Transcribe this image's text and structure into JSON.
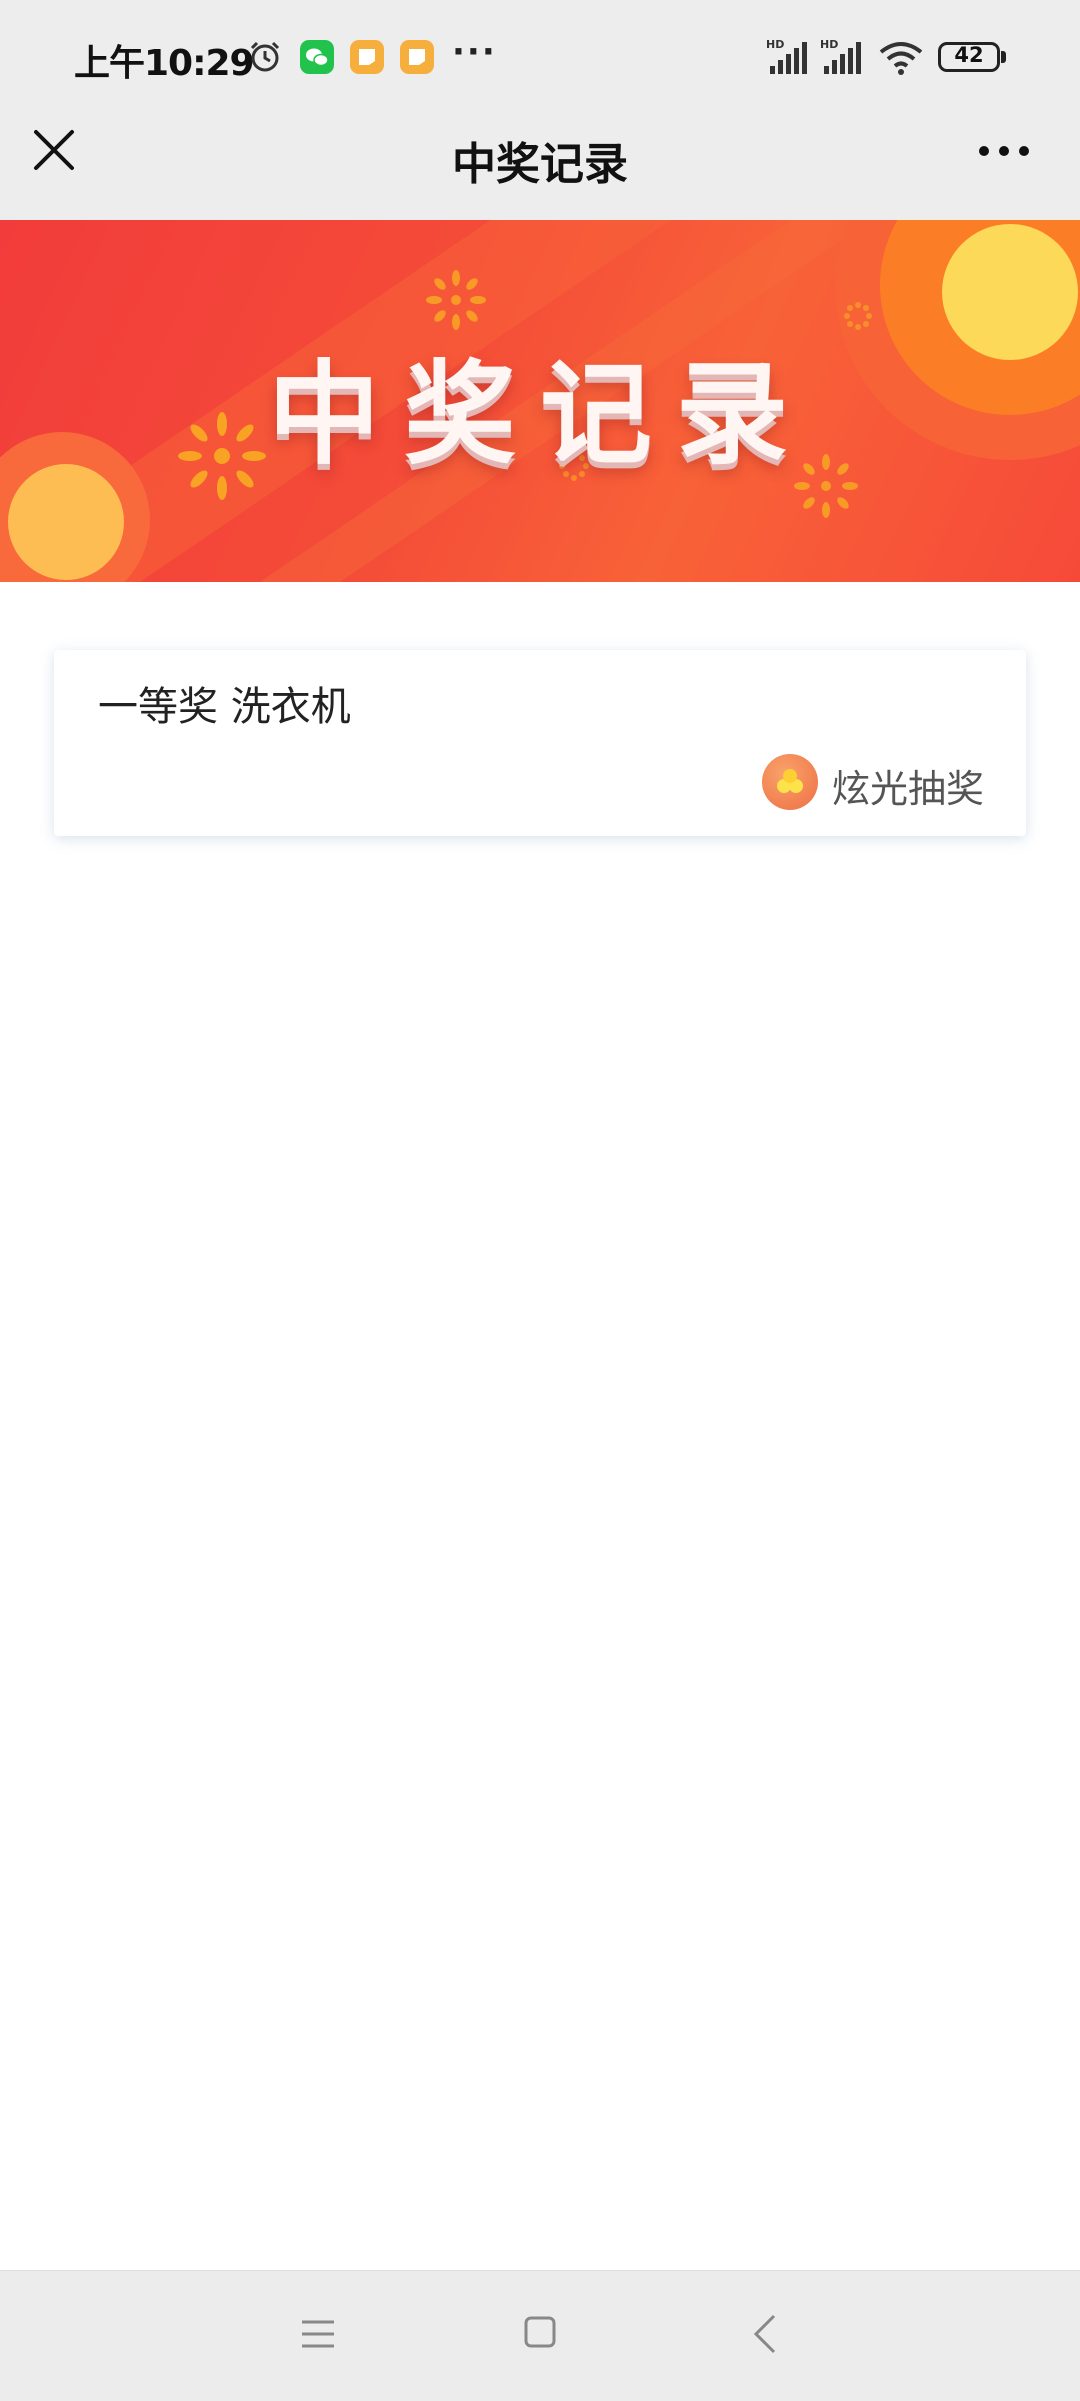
{
  "status_bar": {
    "time": "上午10:29",
    "battery": "42",
    "icons": [
      "alarm-icon",
      "wechat-icon",
      "notes-icon",
      "notes-icon",
      "more-dots-icon",
      "hd-signal-icon",
      "hd-signal-icon",
      "wifi-icon",
      "battery-icon"
    ]
  },
  "nav": {
    "title": "中奖记录",
    "close_icon": "close-icon",
    "more_icon": "more-horizontal-icon"
  },
  "banner": {
    "title": "中奖记录"
  },
  "records": [
    {
      "prize": "一等奖 洗衣机",
      "source": "炫光抽奖",
      "source_icon": "lottery-app-icon"
    }
  ],
  "bottom_nav": {
    "icons": [
      "menu-icon",
      "home-icon",
      "back-icon"
    ]
  },
  "colors": {
    "banner_red": "#f23c3b",
    "banner_orange": "#fb7d25",
    "sun_yellow": "#fdd95a",
    "bar_gray": "#ededed"
  }
}
